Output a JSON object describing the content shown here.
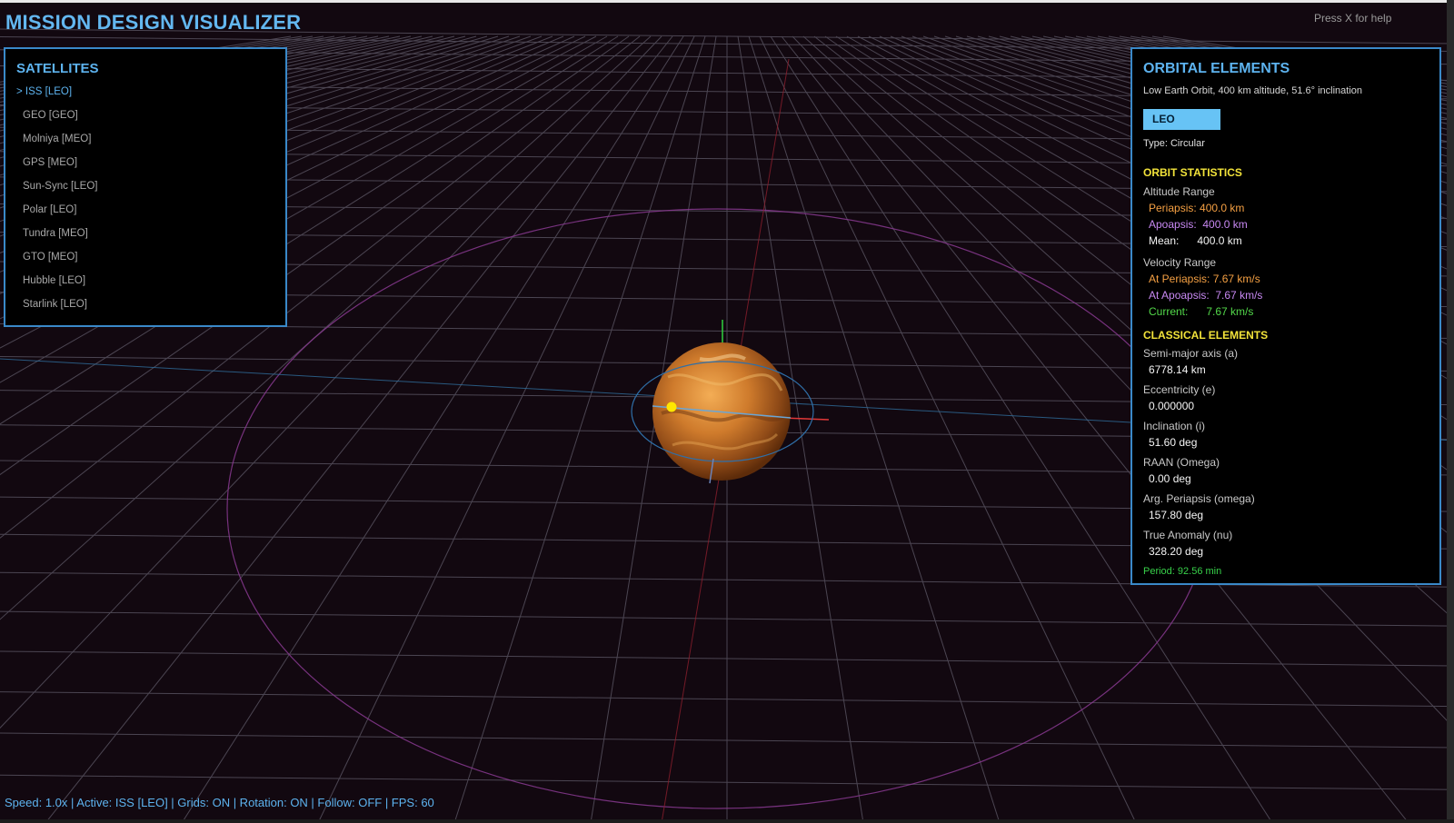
{
  "app": {
    "title": "MISSION DESIGN VISUALIZER",
    "help_hint": "Press X for help"
  },
  "satellites": {
    "title": "SATELLITES",
    "items": [
      {
        "label": "> ISS [LEO]",
        "active": true
      },
      {
        "label": "GEO [GEO]"
      },
      {
        "label": "Molniya [MEO]"
      },
      {
        "label": "GPS [MEO]"
      },
      {
        "label": "Sun-Sync [LEO]"
      },
      {
        "label": "Polar [LEO]"
      },
      {
        "label": "Tundra [MEO]"
      },
      {
        "label": "GTO [MEO]"
      },
      {
        "label": "Hubble [LEO]"
      },
      {
        "label": "Starlink [LEO]"
      }
    ]
  },
  "orbital": {
    "title": "ORBITAL ELEMENTS",
    "description": "Low Earth Orbit, 400 km altitude, 51.6° inclination",
    "orbit_class": "LEO",
    "type": "Type: Circular",
    "stats_title": "ORBIT STATISTICS",
    "altitude_title": "Altitude Range",
    "periapsis_alt": "Periapsis: 400.0 km",
    "apoapsis_alt": "Apoapsis:  400.0 km",
    "mean_alt": "Mean:      400.0 km",
    "velocity_title": "Velocity Range",
    "periapsis_vel": "At Periapsis: 7.67 km/s",
    "apoapsis_vel": "At Apoapsis:  7.67 km/s",
    "current_vel": "Current:      7.67 km/s",
    "classical_title": "CLASSICAL ELEMENTS",
    "elements": [
      {
        "label": "Semi-major axis (a)",
        "value": "6778.14 km"
      },
      {
        "label": "Eccentricity (e)",
        "value": "0.000000"
      },
      {
        "label": "Inclination (i)",
        "value": "51.60 deg"
      },
      {
        "label": "RAAN (Omega)",
        "value": "0.00 deg"
      },
      {
        "label": "Arg. Periapsis (omega)",
        "value": "157.80 deg"
      },
      {
        "label": "True Anomaly (nu)",
        "value": "328.20 deg"
      }
    ],
    "period": "Period: 92.56 min"
  },
  "status": {
    "text": "Speed: 1.0x | Active: ISS [LEO] | Grids: ON | Rotation: ON | Follow: OFF | FPS: 60"
  },
  "colors": {
    "accent": "#5db3ef",
    "section_heading": "#f2e33a",
    "periapsis": "#f5a043",
    "apoapsis": "#c788f2",
    "current": "#53d94a",
    "planet": "#c7782e",
    "satellite": "#ffe600"
  },
  "icons": {
    "planet": "planet-globe",
    "satellite": "satellite-marker"
  }
}
